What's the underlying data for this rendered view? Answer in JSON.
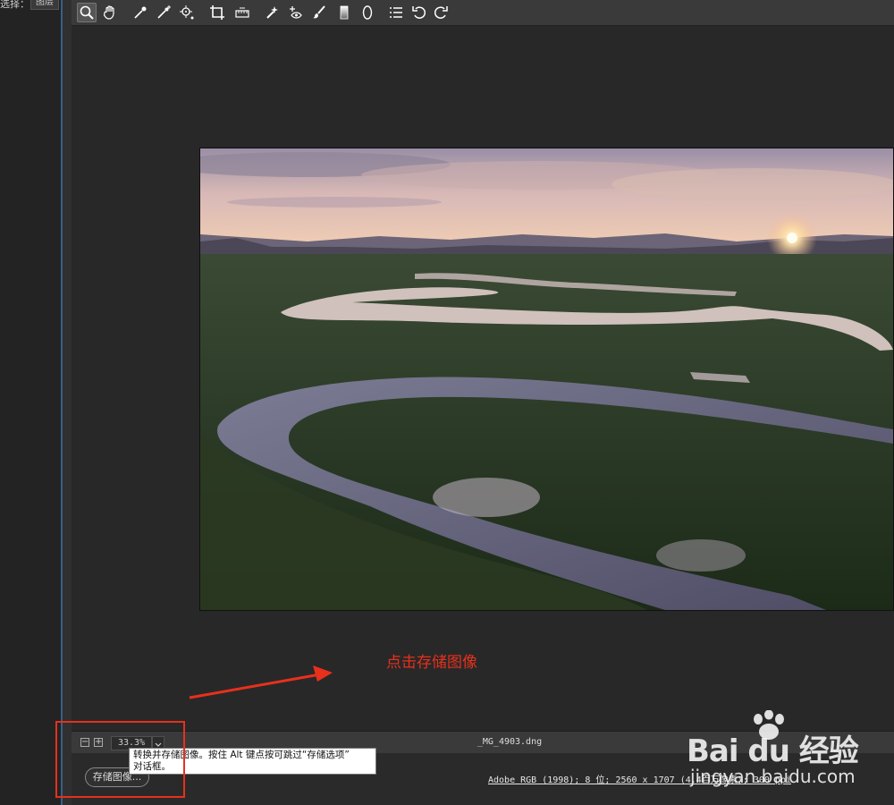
{
  "sidebar": {
    "label": "选择：",
    "chip": "图层"
  },
  "toolbar": {
    "tools": [
      "zoom-icon",
      "hand-icon",
      "white-balance-icon",
      "color-sampler-icon",
      "target-adjustment-icon",
      "crop-icon",
      "straighten-icon",
      "spot-removal-icon",
      "red-eye-icon",
      "adjustment-brush-icon",
      "graduated-filter-icon",
      "radial-filter-icon",
      "presets-list-icon",
      "rotate-left-icon",
      "rotate-right-icon"
    ]
  },
  "annotation": {
    "text": "点击存储图像"
  },
  "status": {
    "zoom": "33.3%",
    "filename": "_MG_4903.dng"
  },
  "bottom": {
    "save_label": "存储图像...",
    "workflow": "Adobe RGB (1998); 8 位; 2560 x 1707 (4.4百万像素); 300 ppi"
  },
  "tooltip": {
    "line1": "转换并存储图像。按住 Alt 键点按可跳过“存储选项”",
    "line2": "对话框。"
  },
  "watermark": {
    "logo": "Bai du 经验",
    "url": "jingyan.baidu.com"
  },
  "colors": {
    "accent_red": "#e8301c",
    "panel": "#3a3a3a",
    "background": "#282828"
  }
}
